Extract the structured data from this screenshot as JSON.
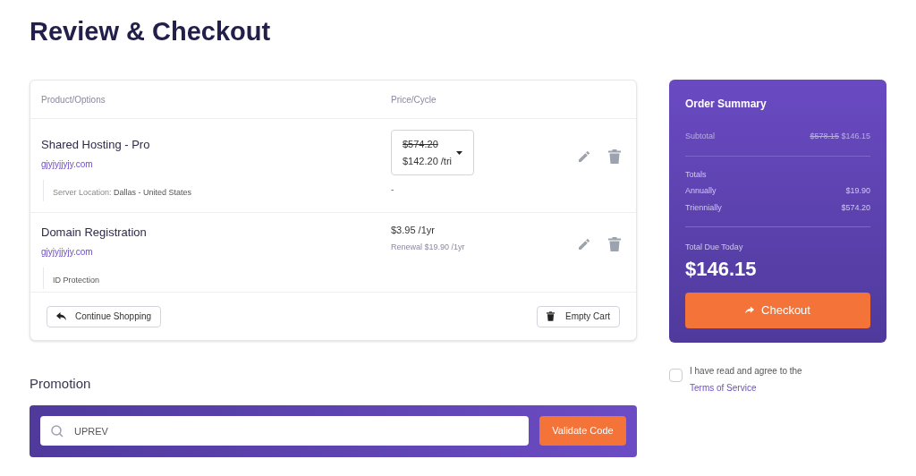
{
  "page_title": "Review & Checkout",
  "cart": {
    "columns": [
      "Product/Options",
      "Price/Cycle"
    ],
    "items": [
      {
        "kind": "cycle-select",
        "name": "Shared Hosting - Pro",
        "domain": "gjyjyjjyjy.com",
        "option_label": "Server Location:",
        "option_value": "Dallas - United States",
        "old_price": "$574.20",
        "price": "$142.20 /tri",
        "note": "-"
      },
      {
        "kind": "plain",
        "name": "Domain Registration",
        "domain": "gjyjyjjyjy.com",
        "option_value": "ID Protection",
        "price": "$3.95 /1yr",
        "note": "Renewal $19.90 /1yr"
      }
    ],
    "continue_button": "Continue Shopping",
    "empty_button": "Empty Cart"
  },
  "promotion": {
    "heading": "Promotion",
    "value": "UPREV",
    "button": "Validate Code"
  },
  "summary": {
    "title": "Order Summary",
    "subtotal_label": "Subtotal",
    "subtotal_old": "$578.15",
    "subtotal": "$146.15",
    "totals_label": "Totals",
    "totals": [
      {
        "label": "Annually",
        "value": "$19.90"
      },
      {
        "label": "Triennially",
        "value": "$574.20"
      }
    ],
    "due_label": "Total Due Today",
    "due": "$146.15",
    "checkout_button": "Checkout"
  },
  "terms": {
    "text": "I have read and agree to the",
    "link": "Terms of Service",
    "checked": false
  }
}
